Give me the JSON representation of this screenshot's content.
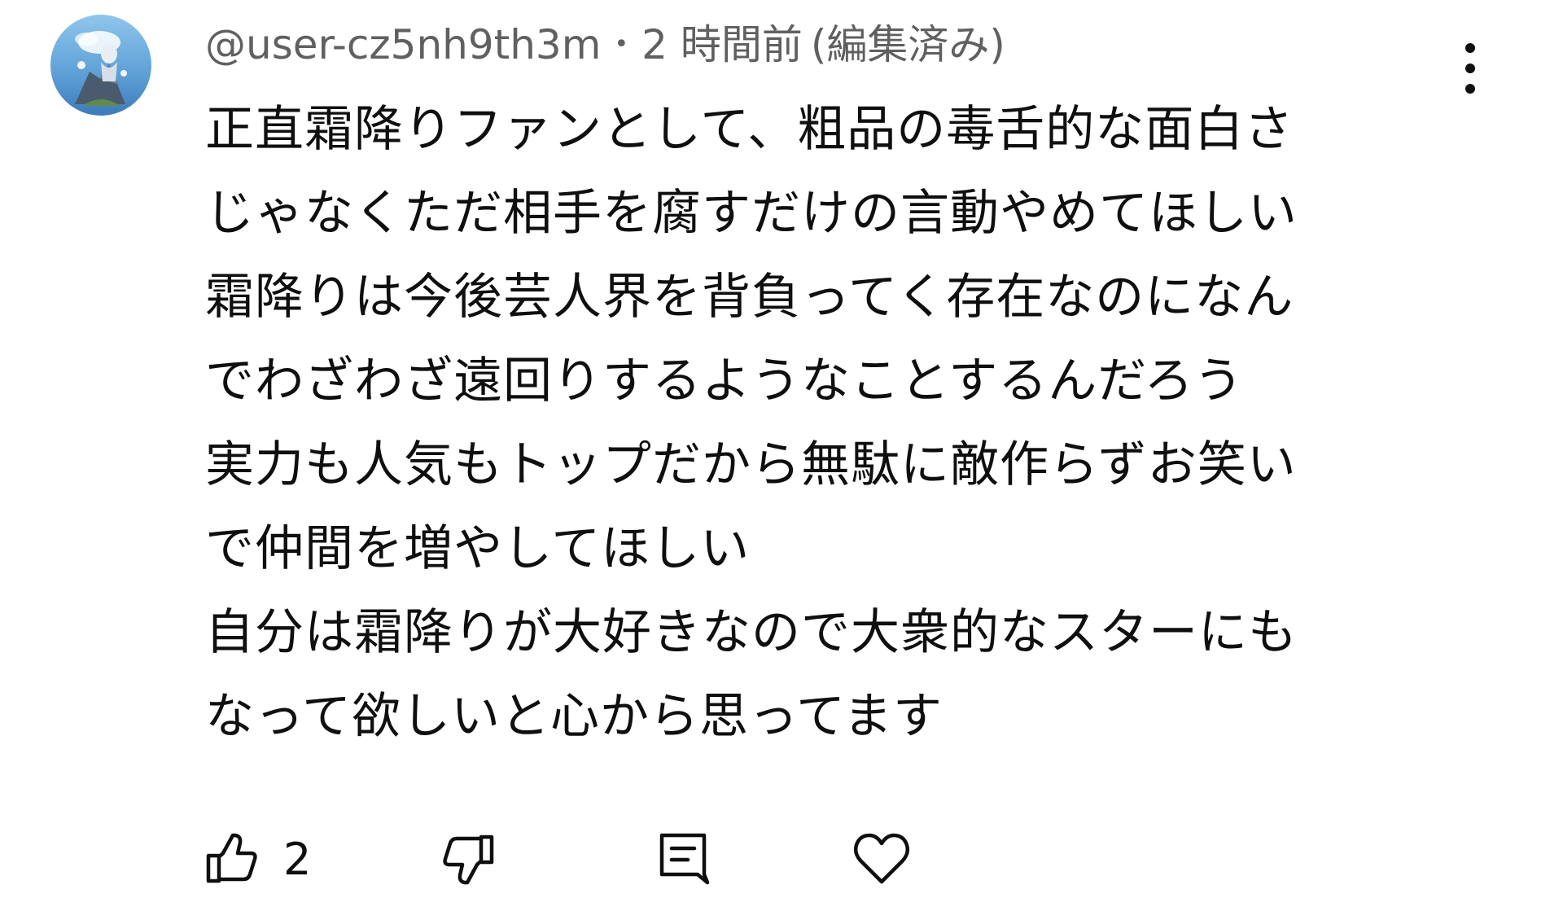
{
  "comment": {
    "author_handle": "@user-cz5nh9th3m",
    "separator": "•",
    "time": "2 時間前",
    "edited": "(編集済み)",
    "lines": [
      "正直霜降りファンとして、粗品の毒舌的な面白さ",
      "じゃなくただ相手を腐すだけの言動やめてほしい",
      "霜降りは今後芸人界を背負ってく存在なのになん",
      "でわざわざ遠回りするようなことするんだろう",
      "実力も人気もトップだから無駄に敵作らずお笑い",
      "で仲間を増やしてほしい",
      "自分は霜降りが大好きなので大衆的なスターにも",
      "なって欲しいと心から思ってます"
    ],
    "like_count": "2"
  },
  "icons": {
    "avatar": "avatar-image",
    "more": "more-vert-icon",
    "like": "thumbs-up-icon",
    "dislike": "thumbs-down-icon",
    "reply": "reply-comment-icon",
    "heart": "heart-icon"
  },
  "colors": {
    "text": "#0f0f0f",
    "meta": "#606060",
    "background": "#ffffff"
  }
}
